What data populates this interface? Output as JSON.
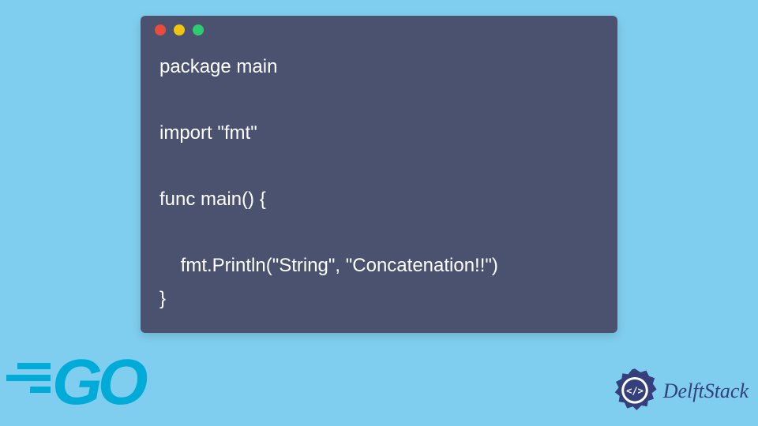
{
  "window": {
    "dots": [
      "red",
      "yellow",
      "green"
    ]
  },
  "code": {
    "lines": "package main\n\nimport \"fmt\"\n\nfunc main() {\n\n    fmt.Println(\"String\", \"Concatenation!!\")\n}"
  },
  "logos": {
    "go_text": "GO",
    "delft_text": "DelftStack",
    "delft_inner": "</>"
  },
  "colors": {
    "bg": "#80ceef",
    "window": "#4b5270",
    "go": "#00acd7",
    "delft": "#343f7c"
  }
}
